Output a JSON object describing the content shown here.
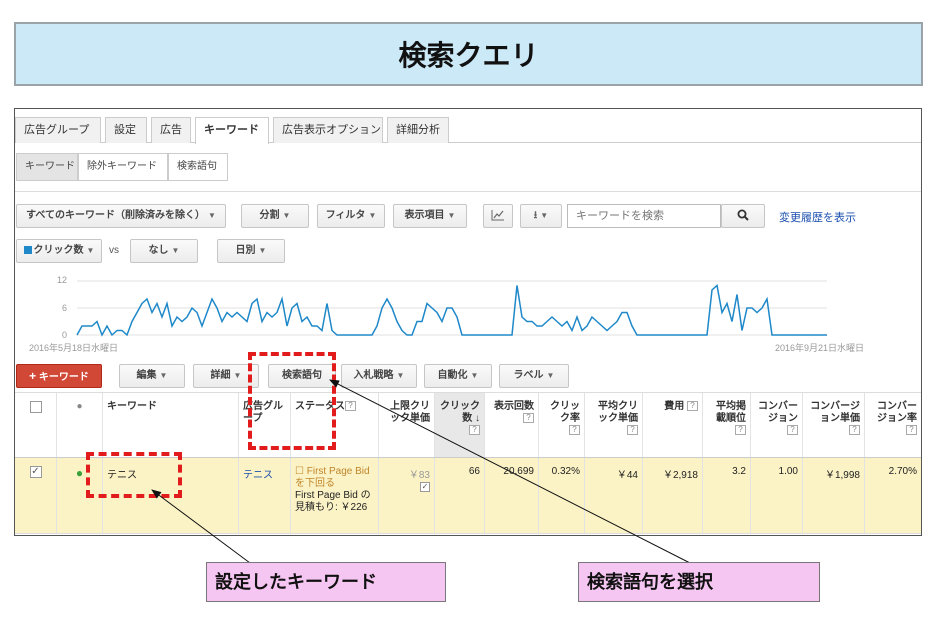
{
  "slide_title": "検索クエリ",
  "tabs": [
    {
      "label": "広告グループ"
    },
    {
      "label": "設定"
    },
    {
      "label": "広告"
    },
    {
      "label": "キーワード"
    },
    {
      "label": "広告表示オプション"
    },
    {
      "label": "詳細分析"
    }
  ],
  "active_tab": "キーワード",
  "subtabs": [
    {
      "label": "キーワード"
    },
    {
      "label": "除外キーワード"
    },
    {
      "label": "検索語句"
    }
  ],
  "toolbar": {
    "filter_all": "すべてのキーワード（削除済みを除く）",
    "segment": "分割",
    "filter": "フィルタ",
    "columns": "表示項目",
    "chart_icon": "line-chart-icon",
    "download_icon": "download-icon",
    "search_placeholder": "キーワードを検索",
    "search_icon": "search-icon",
    "history_link": "変更履歴を表示"
  },
  "chart_controls": {
    "metric": "クリック数",
    "metric_color": "#1e88c9",
    "vs": "vs",
    "compare": "なし",
    "period": "日別"
  },
  "chart_data": {
    "type": "line",
    "ylim": [
      0,
      12
    ],
    "yticks": [
      "12",
      "6",
      "0"
    ],
    "start_label": "2016年5月18日水曜日",
    "end_label": "2016年9月21日水曜日",
    "series": [
      {
        "values": [
          0,
          2,
          2,
          2,
          3,
          0,
          2,
          0,
          1,
          1,
          0,
          3,
          5,
          7,
          8,
          5,
          7,
          4,
          7,
          2,
          4,
          3,
          4,
          6,
          5,
          2,
          5,
          8,
          6,
          3,
          5,
          4,
          5,
          4,
          3,
          7,
          8,
          3,
          5,
          4,
          5,
          8,
          2,
          6,
          7,
          3,
          4,
          2,
          2,
          1,
          7,
          1,
          0,
          0,
          0,
          0,
          0,
          0,
          0,
          0,
          2,
          6,
          8,
          6,
          3,
          1,
          0,
          0,
          3,
          3,
          7,
          6,
          5,
          3,
          6,
          6,
          4,
          0,
          0,
          0,
          0,
          0,
          0,
          0,
          0,
          0,
          0,
          0,
          11,
          4,
          3,
          3,
          2,
          2,
          3,
          4,
          3,
          2,
          3,
          1,
          4,
          1,
          2,
          4,
          3,
          2,
          1,
          2,
          3,
          5,
          5,
          2,
          0,
          0,
          0,
          0,
          0,
          0,
          0,
          0,
          0,
          0,
          0,
          0,
          0,
          0,
          0,
          10,
          11,
          5,
          7,
          3,
          9,
          1,
          6,
          6,
          5,
          6,
          8,
          0,
          0,
          0,
          0,
          0,
          0,
          0,
          0,
          0,
          0,
          0,
          0
        ]
      }
    ]
  },
  "add_keyword": "キーワード",
  "action_buttons": {
    "edit": "編集",
    "details": "詳細",
    "search_terms": "検索語句",
    "bid_strategy": "入札戦略",
    "automate": "自動化",
    "labels": "ラベル"
  },
  "table": {
    "headers": {
      "status_dot": "●",
      "keyword": "キーワード",
      "ad_group": "広告グループ",
      "status": "ステータス",
      "max_cpc": "上限クリック単価",
      "clicks": "クリック数",
      "impressions": "表示回数",
      "ctr": "クリック率",
      "avg_cpc": "平均クリック単価",
      "cost": "費用",
      "avg_pos": "平均掲載順位",
      "conversions": "コンバージョン",
      "cost_per_conv": "コンバージョン単価",
      "conv_rate": "コンバージョン率"
    },
    "row": {
      "keyword": "テニス",
      "ad_group": "テニス",
      "status_line1": "First Page Bid を下回る",
      "status_line2": "First Page Bid の見積もり: ￥226",
      "max_cpc": "￥83",
      "clicks": "66",
      "impressions": "20,699",
      "ctr": "0.32%",
      "avg_cpc": "￥44",
      "cost": "￥2,918",
      "avg_pos": "3.2",
      "conversions": "1.00",
      "cost_per_conv": "￥1,998",
      "conv_rate": "2.70%"
    }
  },
  "callouts": {
    "keyword_set": "設定したキーワード",
    "select_search_terms": "検索語句を選択"
  }
}
